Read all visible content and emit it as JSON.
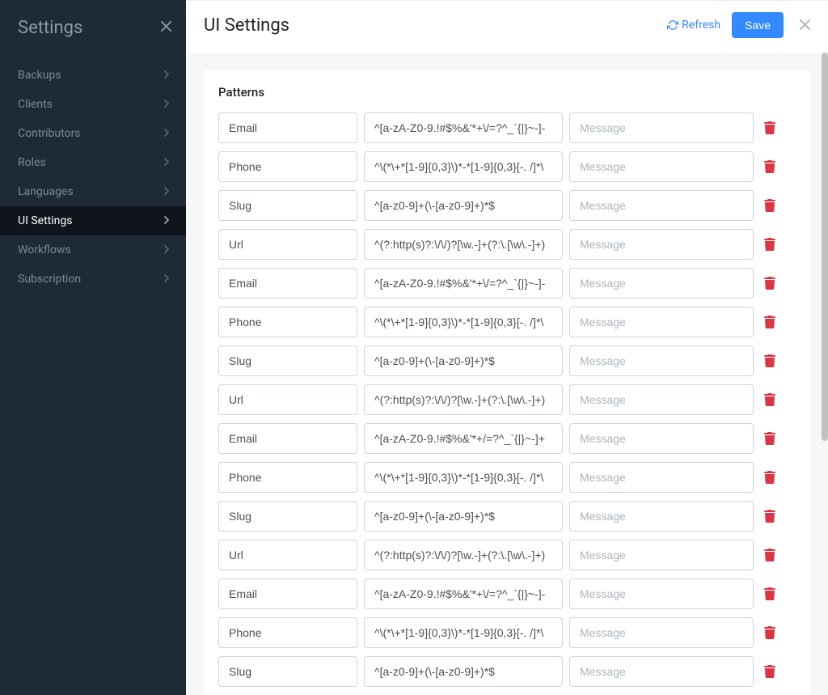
{
  "sidebar": {
    "title": "Settings",
    "items": [
      {
        "label": "Backups",
        "active": false
      },
      {
        "label": "Clients",
        "active": false
      },
      {
        "label": "Contributors",
        "active": false
      },
      {
        "label": "Roles",
        "active": false
      },
      {
        "label": "Languages",
        "active": false
      },
      {
        "label": "UI Settings",
        "active": true
      },
      {
        "label": "Workflows",
        "active": false
      },
      {
        "label": "Subscription",
        "active": false
      }
    ]
  },
  "header": {
    "title": "UI Settings",
    "refresh": "Refresh",
    "save": "Save"
  },
  "panel": {
    "title": "Patterns",
    "message_placeholder": "Message",
    "rows": [
      {
        "name": "Email",
        "regex": "^[a-zA-Z0-9.!#$%&'*+\\/=?^_`{|}~-]-",
        "message": ""
      },
      {
        "name": "Phone",
        "regex": "^\\(*\\+*[1-9]{0,3}\\)*-*[1-9]{0,3}[-. /]*\\",
        "message": ""
      },
      {
        "name": "Slug",
        "regex": "^[a-z0-9]+(\\-[a-z0-9]+)*$",
        "message": ""
      },
      {
        "name": "Url",
        "regex": "^(?:http(s)?:\\/\\/)?[\\w.-]+(?:\\.[\\w\\.-]+)",
        "message": ""
      },
      {
        "name": "Email",
        "regex": "^[a-zA-Z0-9.!#$%&'*+\\/=?^_`{|}~-]-",
        "message": ""
      },
      {
        "name": "Phone",
        "regex": "^\\(*\\+*[1-9]{0,3}\\)*-*[1-9]{0,3}[-. /]*\\",
        "message": ""
      },
      {
        "name": "Slug",
        "regex": "^[a-z0-9]+(\\-[a-z0-9]+)*$",
        "message": ""
      },
      {
        "name": "Url",
        "regex": "^(?:http(s)?:\\/\\/)?[\\w.-]+(?:\\.[\\w\\.-]+)",
        "message": ""
      },
      {
        "name": "Email",
        "regex": "^[a-zA-Z0-9.!#$%&'*+/=?^_`{|}~-]+",
        "message": ""
      },
      {
        "name": "Phone",
        "regex": "^\\(*\\+*[1-9]{0,3}\\)*-*[1-9]{0,3}[-. /]*\\",
        "message": ""
      },
      {
        "name": "Slug",
        "regex": "^[a-z0-9]+(\\-[a-z0-9]+)*$",
        "message": ""
      },
      {
        "name": "Url",
        "regex": "^(?:http(s)?:\\/\\/)?[\\w.-]+(?:\\.[\\w\\.-]+)",
        "message": ""
      },
      {
        "name": "Email",
        "regex": "^[a-zA-Z0-9.!#$%&'*+\\/=?^_`{|}~-]-",
        "message": ""
      },
      {
        "name": "Phone",
        "regex": "^\\(*\\+*[1-9]{0,3}\\)*-*[1-9]{0,3}[-. /]*\\",
        "message": ""
      },
      {
        "name": "Slug",
        "regex": "^[a-z0-9]+(\\-[a-z0-9]+)*$",
        "message": ""
      }
    ]
  }
}
